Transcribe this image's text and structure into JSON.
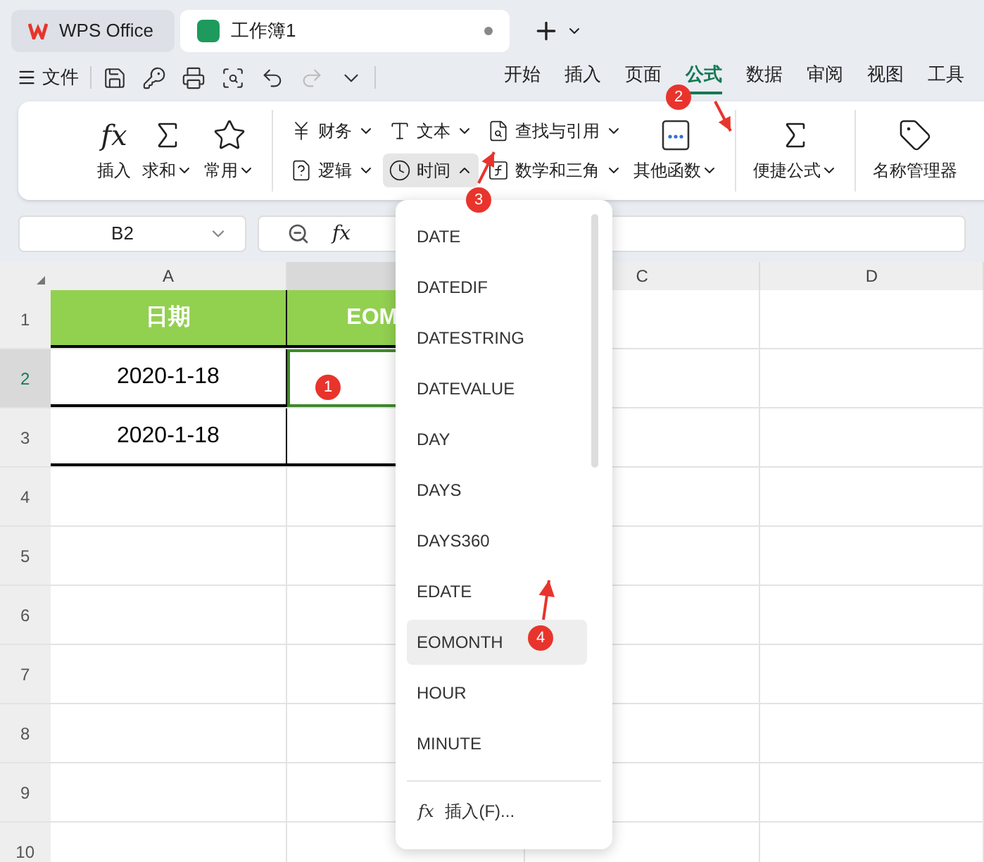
{
  "app_tabs": [
    {
      "label": "WPS Office",
      "kind": "home",
      "selected": false
    },
    {
      "label": "工作簿1",
      "kind": "doc",
      "selected": true
    }
  ],
  "menu": {
    "file": "文件",
    "quick_access": [
      {
        "disabled": false
      },
      {
        "disabled": false
      },
      {
        "disabled": false
      },
      {
        "disabled": false
      },
      {
        "disabled": false
      },
      {
        "disabled": true
      },
      {
        "disabled": false
      }
    ],
    "tabs": [
      {
        "label": "开始",
        "selected": false
      },
      {
        "label": "插入",
        "selected": false
      },
      {
        "label": "页面",
        "selected": false
      },
      {
        "label": "公式",
        "selected": true
      },
      {
        "label": "数据",
        "selected": false
      },
      {
        "label": "审阅",
        "selected": false
      },
      {
        "label": "视图",
        "selected": false
      },
      {
        "label": "工具",
        "selected": false
      }
    ]
  },
  "ribbon": {
    "left": [
      {
        "label": "插入",
        "glyph": "fx",
        "caret": false
      },
      {
        "label": "求和",
        "caret": true
      },
      {
        "label": "常用",
        "caret": true
      }
    ],
    "small": [
      [
        {
          "label": "财务",
          "caret": true,
          "open": false
        },
        {
          "label": "逻辑",
          "caret": true,
          "open": false
        }
      ],
      [
        {
          "label": "文本",
          "caret": true,
          "open": false
        },
        {
          "label": "时间",
          "caret": true,
          "open": true
        }
      ],
      [
        {
          "label": "查找与引用",
          "caret": true,
          "open": false
        },
        {
          "label": "数学和三角",
          "caret": true,
          "open": false
        }
      ]
    ],
    "other": {
      "label": "其他函数",
      "caret": true
    },
    "right": [
      {
        "label": "便捷公式",
        "caret": true
      },
      {
        "label": "名称管理器",
        "caret": false
      }
    ]
  },
  "formula_bar": {
    "name_box": "B2",
    "fx": "fx"
  },
  "columns": [
    {
      "label": "A",
      "selected": false
    },
    {
      "selected": true
    },
    {
      "label": "C",
      "selected": false
    },
    {
      "label": "D",
      "selected": false
    }
  ],
  "rows": [
    {
      "num": "1",
      "kind": "header",
      "selected": false,
      "cells": {
        "A": "日期",
        "B": "EOM"
      }
    },
    {
      "num": "2",
      "kind": "data",
      "selected": true,
      "cells": {
        "A": "2020-1-18"
      }
    },
    {
      "num": "3",
      "kind": "data",
      "selected": false,
      "cells": {
        "A": "2020-1-18"
      }
    },
    {
      "num": "4",
      "kind": "blank",
      "selected": false
    },
    {
      "num": "5",
      "kind": "blank",
      "selected": false
    },
    {
      "num": "6",
      "kind": "blank",
      "selected": false
    },
    {
      "num": "7",
      "kind": "blank",
      "selected": false
    },
    {
      "num": "8",
      "kind": "blank",
      "selected": false
    },
    {
      "num": "9",
      "kind": "blank",
      "selected": false
    },
    {
      "num": "10",
      "kind": "blank",
      "selected": false
    }
  ],
  "dropdown": {
    "items": [
      {
        "label": "DATE",
        "selected": false
      },
      {
        "label": "DATEDIF",
        "selected": false
      },
      {
        "label": "DATESTRING",
        "selected": false
      },
      {
        "label": "DATEVALUE",
        "selected": false
      },
      {
        "label": "DAY",
        "selected": false
      },
      {
        "label": "DAYS",
        "selected": false
      },
      {
        "label": "DAYS360",
        "selected": false
      },
      {
        "label": "EDATE",
        "selected": false
      },
      {
        "label": "EOMONTH",
        "selected": true
      },
      {
        "label": "HOUR",
        "selected": false
      },
      {
        "label": "MINUTE",
        "selected": false
      }
    ],
    "footer": {
      "glyph": "fx",
      "label": "插入(F)..."
    }
  },
  "annotations": [
    {
      "label": "1"
    },
    {
      "label": "2"
    },
    {
      "label": "3"
    },
    {
      "label": "4"
    }
  ]
}
